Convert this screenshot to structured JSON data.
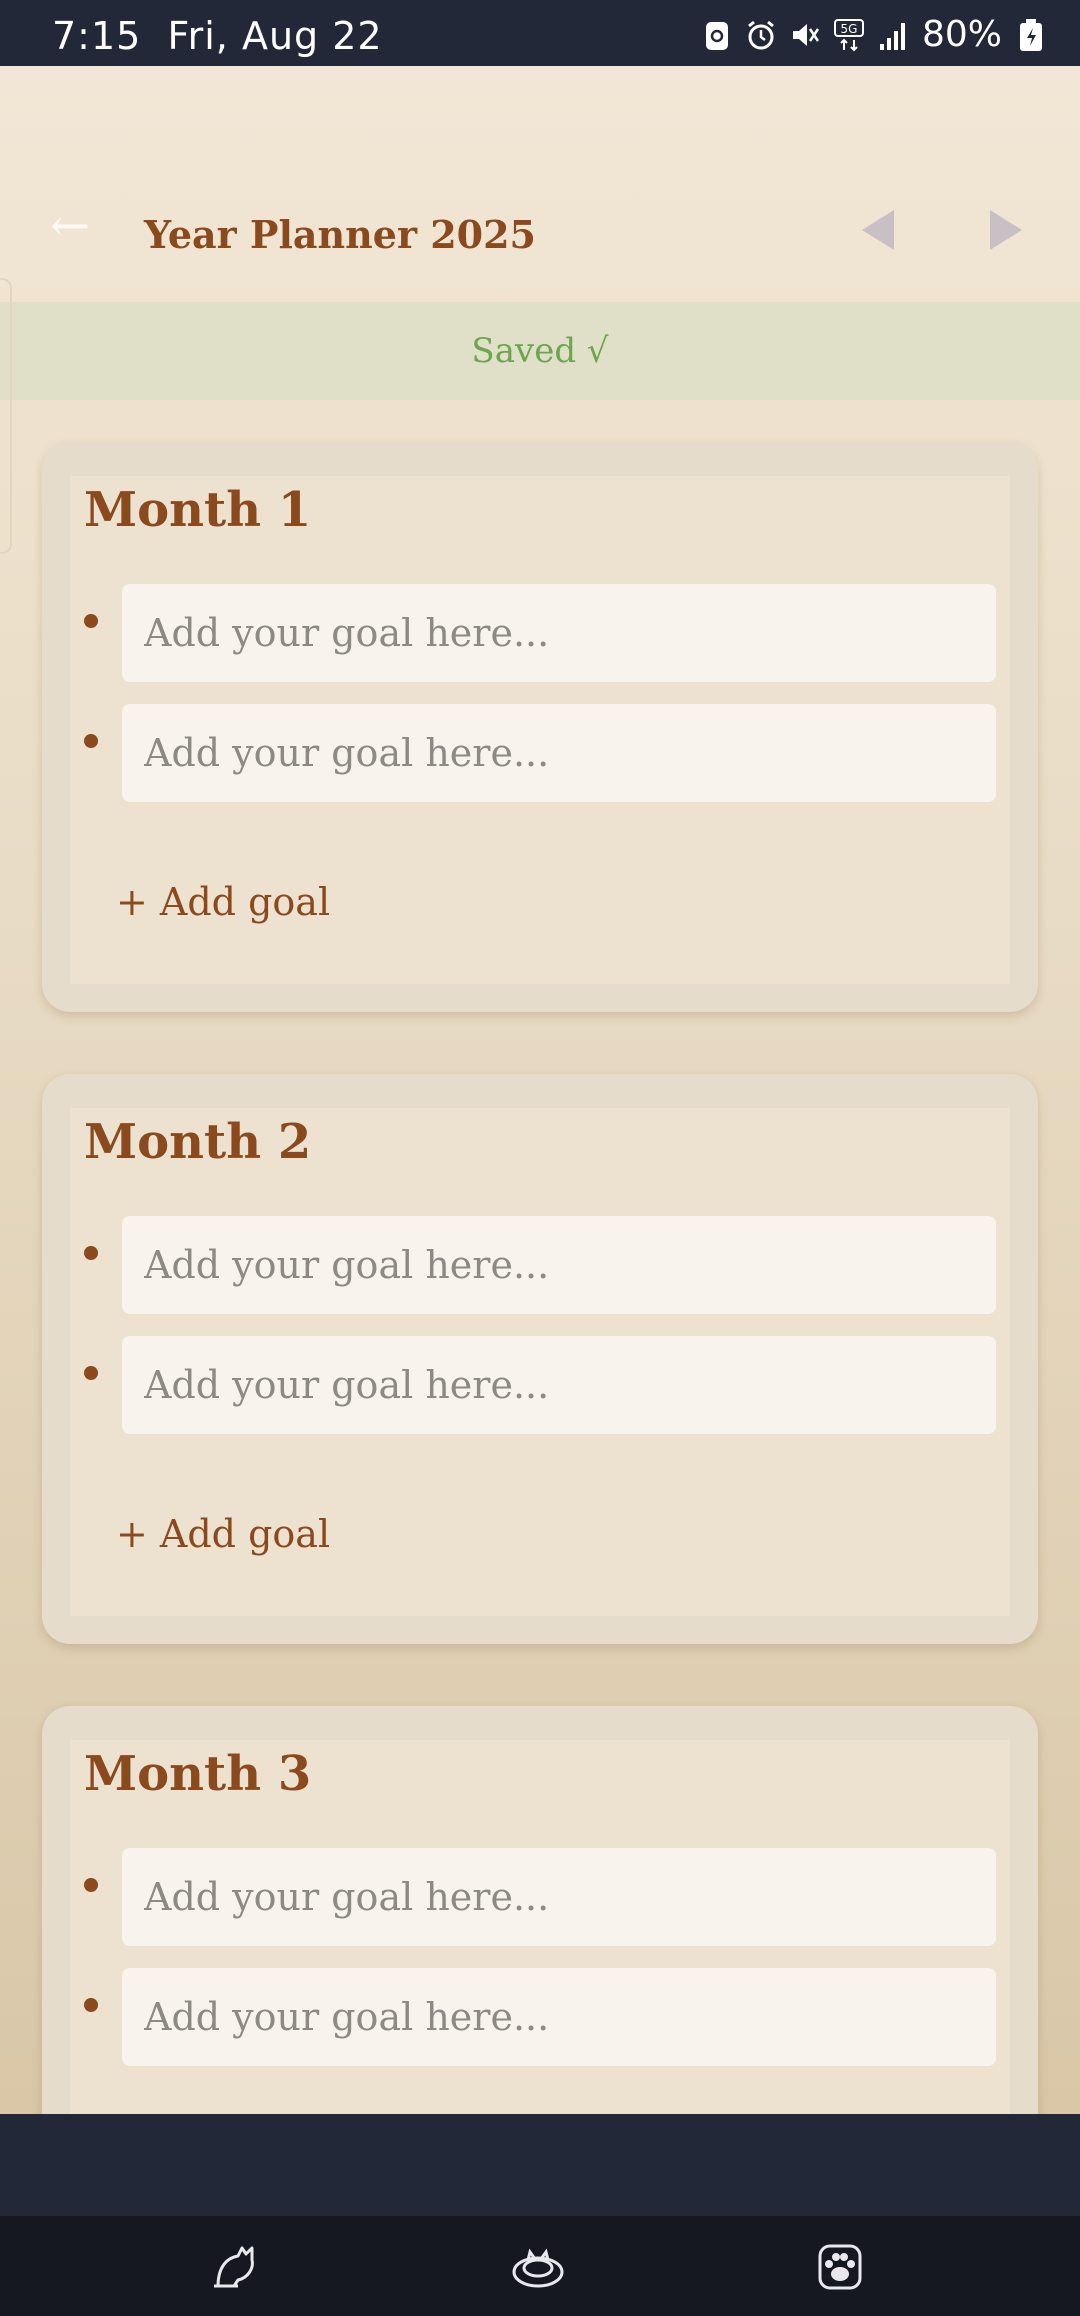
{
  "status_bar": {
    "time": "7:15",
    "date": "Fri, Aug 22",
    "battery": "80%",
    "icons": [
      "sync-icon",
      "alarm-icon",
      "mute-icon",
      "5g-icon",
      "signal-icon",
      "battery-icon"
    ]
  },
  "header": {
    "back_symbol": "←",
    "title": "Year Planner 2025",
    "prev_icon": "triangle-left-icon",
    "next_icon": "triangle-right-icon"
  },
  "save_status": "Saved √",
  "goal_placeholder": "Add your goal here...",
  "add_goal_label": "+ Add goal",
  "months": [
    {
      "title": "Month 1",
      "goals": [
        "",
        ""
      ]
    },
    {
      "title": "Month 2",
      "goals": [
        "",
        ""
      ]
    },
    {
      "title": "Month 3",
      "goals": [
        "",
        ""
      ]
    }
  ],
  "colors": {
    "accent": "#8a4a1e",
    "saved_text": "#6ea54f",
    "background": "#efe4d2"
  },
  "nav_bar": {
    "icons": [
      "cat-stretch-icon",
      "cat-sleeping-icon",
      "paw-icon"
    ]
  }
}
